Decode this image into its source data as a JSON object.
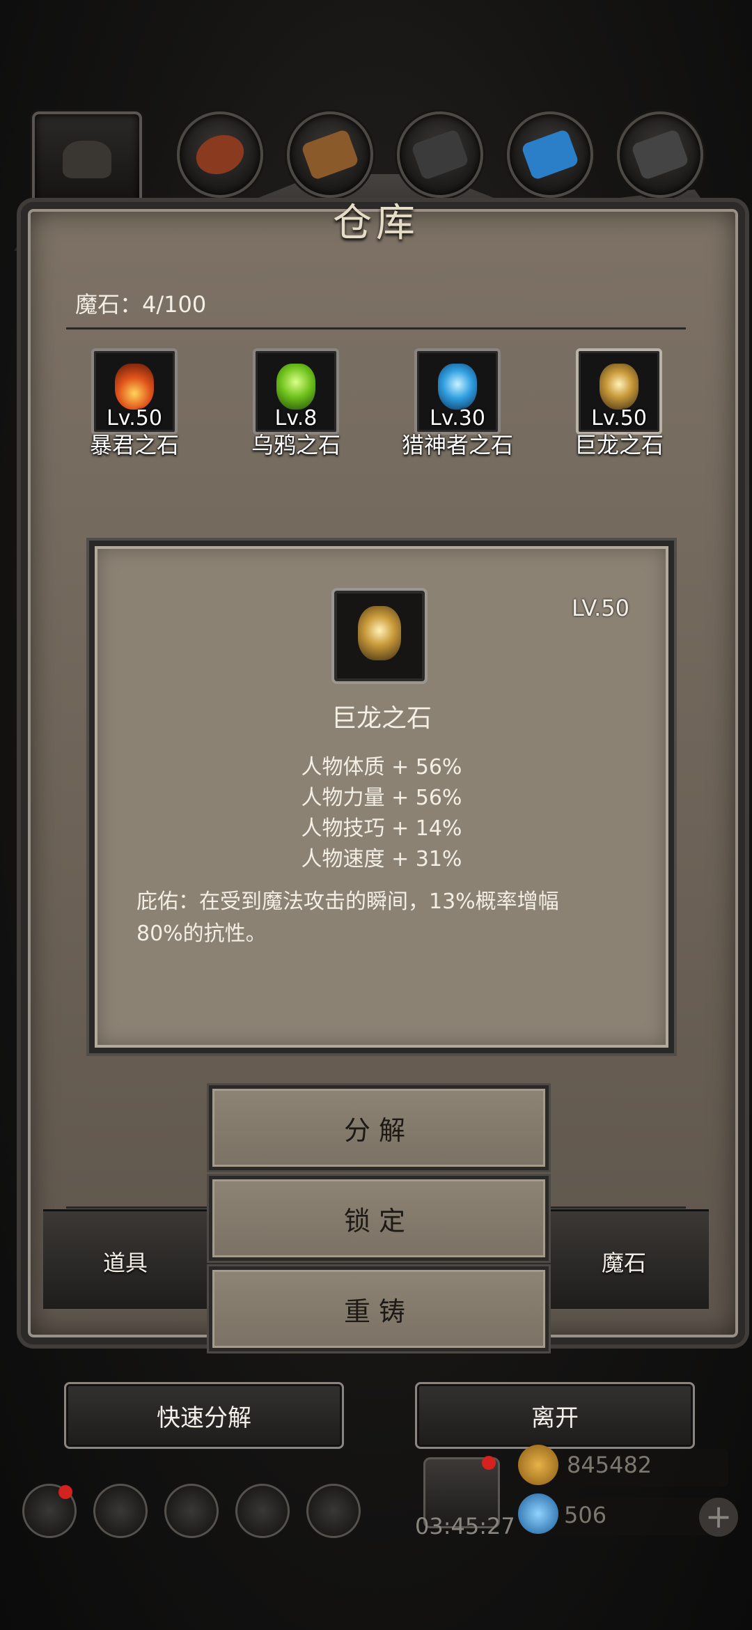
{
  "header": {
    "title": "仓库"
  },
  "categories": [
    {
      "icon": "helmet-icon",
      "color": "#3a3733",
      "active": true
    },
    {
      "icon": "leather-icon",
      "color": "#8a3a1e"
    },
    {
      "icon": "wood-icon",
      "color": "#8a5a2a"
    },
    {
      "icon": "iron-icon",
      "color": "#3b3b3b"
    },
    {
      "icon": "crystal-icon",
      "color": "#2a7fc8"
    },
    {
      "icon": "stone-icon",
      "color": "#444444"
    }
  ],
  "capacity": "魔石：4/100",
  "stones": [
    {
      "name": "暴君之石",
      "level": "Lv.50",
      "color": "#d9441a"
    },
    {
      "name": "乌鸦之石",
      "level": "Lv.8",
      "color": "#7ccf2a"
    },
    {
      "name": "猎神者之石",
      "level": "Lv.30",
      "color": "#35a6e0"
    },
    {
      "name": "巨龙之石",
      "level": "Lv.50",
      "color": "#c9a64a"
    }
  ],
  "detail": {
    "level": "LV.50",
    "name": "巨龙之石",
    "stats": [
      "人物体质 + 56%",
      "人物力量 + 56%",
      "人物技巧 + 14%",
      "人物速度 + 31%"
    ],
    "blessing": "庇佑：在受到魔法攻击的瞬间，13%概率增幅80%的抗性。"
  },
  "actions": {
    "decompose": "分解",
    "lock": "锁定",
    "reforge": "重铸"
  },
  "bottom_tabs": {
    "items": "道具",
    "magic_stone": "魔石"
  },
  "footer": {
    "quick_decompose": "快速分解",
    "leave": "离开"
  },
  "hud": {
    "gold": "845482",
    "gems": "506",
    "timer": "03:45:27"
  }
}
